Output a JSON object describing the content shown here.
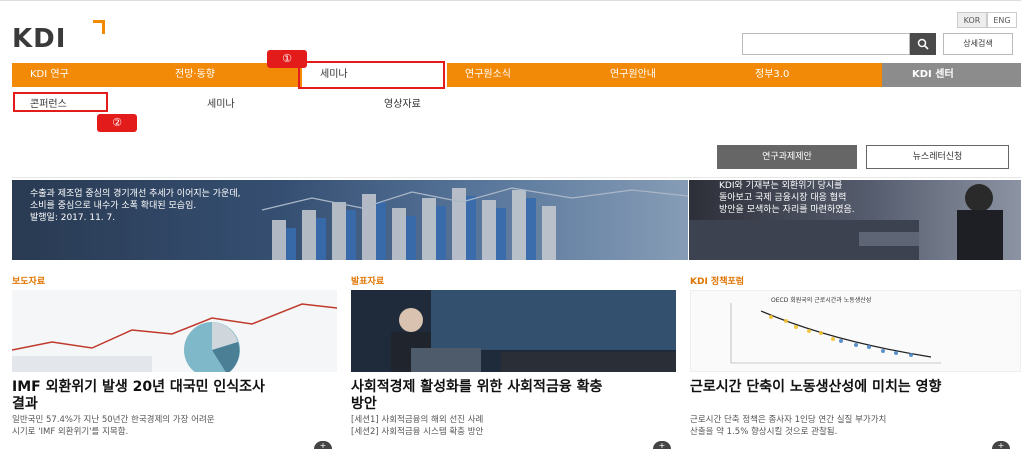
{
  "header": {
    "logo_text": "KDI",
    "lang": [
      "KOR",
      "ENG"
    ],
    "search_placeholder": "",
    "detail_search_label": "상세검색"
  },
  "gnb": [
    {
      "label": "KDI 연구"
    },
    {
      "label": "전망·동향"
    },
    {
      "label": "세미나"
    },
    {
      "label": "연구원소식"
    },
    {
      "label": "연구원안내"
    },
    {
      "label": "정부3.0"
    },
    {
      "label": "KDI 센터"
    }
  ],
  "snb": [
    {
      "label": "콘퍼런스"
    },
    {
      "label": "세미나"
    },
    {
      "label": "영상자료"
    }
  ],
  "buttons": {
    "proposal": "연구과제제안",
    "newsletter": "뉴스레터신청"
  },
  "annotations": {
    "badge1": "①",
    "badge2": "②"
  },
  "hero": {
    "left_line1": "수출과 제조업 중심의 경기개선 추세가 이어지는 가운데,",
    "left_line2": "소비를 중심으로 내수가 소폭 확대된 모습임.",
    "left_line3": "발행일: 2017. 11. 7.",
    "right_line1": "KDI와 기재부는 외환위기 당시를",
    "right_line2": "돌아보고 국제 금융시장 대응 협력",
    "right_line3": "방안을 모색하는 자리를 마련하였음."
  },
  "cards": [
    {
      "section": "보도자료",
      "title_line1": "IMF 외환위기 발생 20년 대국민 인식조사",
      "title_line2": "결과",
      "desc_line1": "일반국민 57.4%가 지난 50년간 한국경제의 가장 어려운",
      "desc_line2": "시기로 'IMF 외환위기'를 지목함."
    },
    {
      "section": "발표자료",
      "title_line1": "사회적경제 활성화를 위한 사회적금융 확충",
      "title_line2": "방안",
      "desc_line1": "[세션1] 사회적금융의 해외 선진 사례",
      "desc_line2": "[세션2] 사회적금융 시스템 확충 방안"
    },
    {
      "section": "KDI 정책포럼",
      "title_line1": "근로시간 단축이 노동생산성에 미치는 영향",
      "title_line2": "",
      "desc_line1": "근로시간 단축 정책은 종사자 1인당 연간 실질 부가가치",
      "desc_line2": "산출을 약 1.5% 향상시킬 것으로 관찰됨."
    }
  ],
  "chart_thumb_title": "OECD 회원국의 근로시간과 노동생산성",
  "plus_label": "+",
  "colors": {
    "accent": "#f28a08",
    "center_tab": "#8c8c8c",
    "annotation": "#e31b1b"
  }
}
